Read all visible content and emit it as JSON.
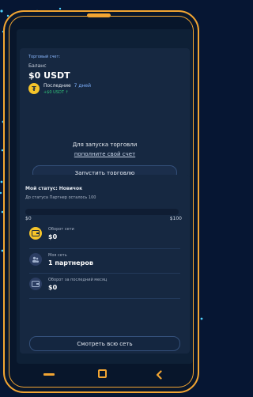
{
  "account": {
    "label": "Торговый счет:",
    "balance_label": "Баланс",
    "balance_value": "$0 USDT",
    "last_label": "Последние",
    "last_period": "7 дней",
    "last_change": "+$0 USDT ↑",
    "cta_text": "Для запуска торговли",
    "cta_link": "пополните свой счет",
    "start_button": "Запустить торговлю"
  },
  "status": {
    "title_prefix": "Мой статус:",
    "title_value": "Новичок",
    "subtitle": "До статуса Партнер осталось 100",
    "progress": 0,
    "min_label": "$0",
    "max_label": "$100"
  },
  "stats": [
    {
      "label": "Оборот сети",
      "value": "$0",
      "icon": "wallet-icon",
      "color": "#f5c42a"
    },
    {
      "label": "Моя сеть",
      "value": "1 партнеров",
      "icon": "users-icon",
      "color": "#2c3e63"
    },
    {
      "label": "Оборот за последний месяц",
      "value": "$0",
      "icon": "calendar-wallet-icon",
      "color": "#2c3e63"
    }
  ],
  "network_button": "Смотреть всю сеть",
  "nav": {
    "minus": "—",
    "square": "□",
    "back": "‹"
  },
  "colors": {
    "accent": "#f2a532",
    "bg": "#061633",
    "card": "#162841",
    "green": "#31c27a"
  }
}
